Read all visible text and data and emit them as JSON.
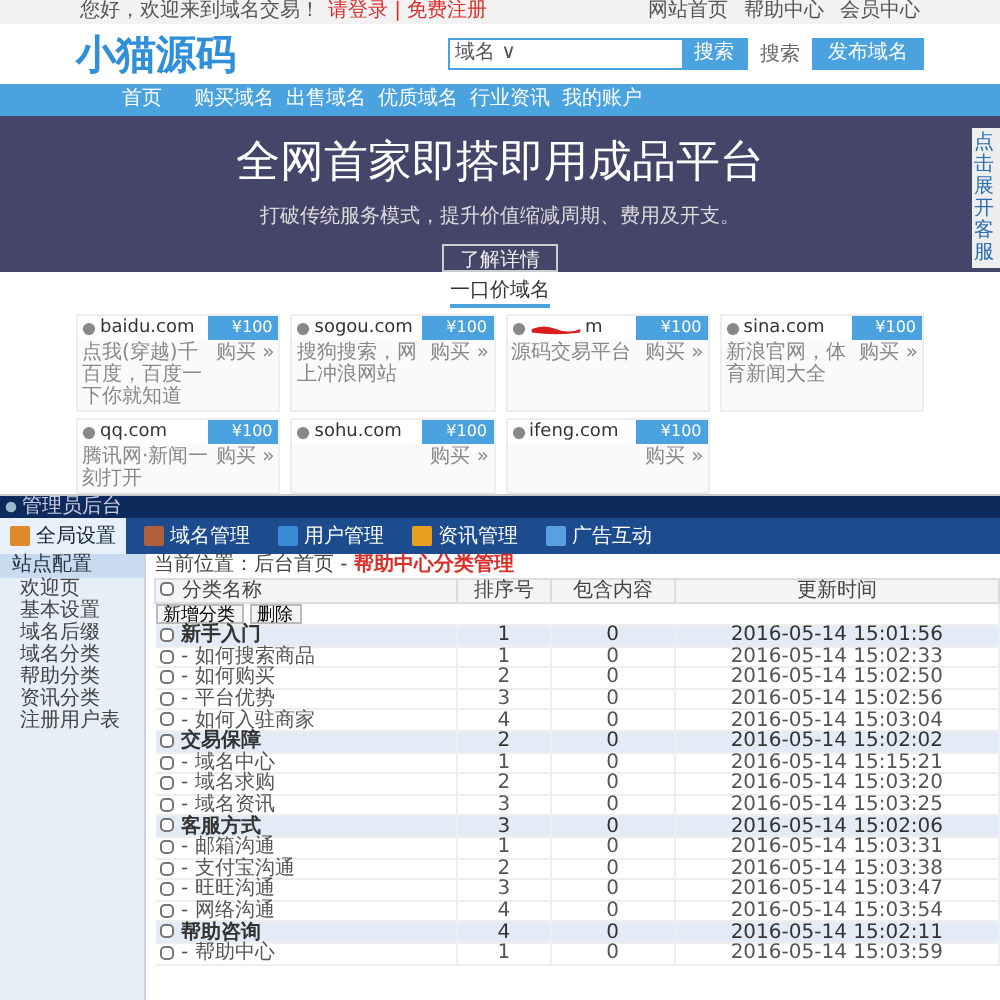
{
  "top_bar": {
    "welcome": "您好，欢迎来到域名交易！",
    "login": "请登录 | 免费注册",
    "links": [
      "网站首页",
      "帮助中心",
      "会员中心"
    ]
  },
  "header": {
    "logo": "小猫源码",
    "search": {
      "select": "域名 ∨",
      "button": "搜索"
    },
    "hint": "搜索",
    "publish": "发布域名"
  },
  "nav": [
    {
      "label": "首页",
      "selected": false
    },
    {
      "label": "购买域名",
      "selected": false
    },
    {
      "label": "出售域名",
      "selected": false
    },
    {
      "label": "优质域名",
      "selected": false
    },
    {
      "label": "行业资讯",
      "selected": false
    },
    {
      "label": "我的账户",
      "selected": false
    }
  ],
  "hero": {
    "title": "全网首家即搭即用成品平台",
    "subtitle": "打破传统服务模式，提升价值缩减周期、费用及开支。",
    "button": "了解详情"
  },
  "side_tab": "点击展开客服",
  "section_title": "一口价域名",
  "domains": [
    {
      "domain": "baidu.com",
      "redacted": false,
      "price": "¥100",
      "desc": "点我(穿越)千百度，百度一下你就知道",
      "buy": "购买 »"
    },
    {
      "domain": "sogou.com",
      "redacted": false,
      "price": "¥100",
      "desc": "搜狗搜索，网上冲浪网站",
      "buy": "购买 »"
    },
    {
      "domain": "m",
      "redacted": true,
      "price": "¥100",
      "desc": "源码交易平台",
      "buy": "购买 »"
    },
    {
      "domain": "sina.com",
      "redacted": false,
      "price": "¥100",
      "desc": "新浪官网，体育新闻大全",
      "buy": "购买 »"
    },
    {
      "domain": "qq.com",
      "redacted": false,
      "price": "¥100",
      "desc": "腾讯网·新闻一刻打开",
      "buy": "购买 »"
    },
    {
      "domain": "sohu.com",
      "redacted": false,
      "price": "¥100",
      "buy": "购买 »"
    },
    {
      "domain": "ifeng.com",
      "redacted": false,
      "price": "¥100",
      "buy": "购买 »"
    }
  ],
  "admin": {
    "title": "管理员后台",
    "tabs": [
      {
        "label": "全局设置",
        "selected": true,
        "color": "#e0892a"
      },
      {
        "label": "域名管理",
        "selected": false,
        "color": "#b0603a"
      },
      {
        "label": "用户管理",
        "selected": false,
        "color": "#3a8ad8"
      },
      {
        "label": "资讯管理",
        "selected": false,
        "color": "#e8a020"
      },
      {
        "label": "广告互动",
        "selected": false,
        "color": "#5aa0e0"
      }
    ],
    "sidebar": {
      "title": "站点配置",
      "items": [
        "欢迎页",
        "基本设置",
        "域名后缀",
        "域名分类",
        "帮助分类",
        "资讯分类",
        "注册用户表"
      ]
    },
    "breadcrumb": {
      "prefix": "当前位置：后台首页 - ",
      "current": "帮助中心分类管理"
    },
    "columns": [
      "分类名称",
      "排序号",
      "包含内容",
      "更新时间"
    ],
    "select_all_checked": false,
    "buttons": [
      "新增分类",
      "删除"
    ],
    "rows": [
      {
        "kind": "group",
        "name": "新手入门",
        "order": "1",
        "count": "0",
        "time": "2016-05-14 15:01:56",
        "checked": false
      },
      {
        "kind": "item",
        "name": "- 如何搜索商品",
        "order": "1",
        "count": "0",
        "time": "2016-05-14 15:02:33",
        "checked": false
      },
      {
        "kind": "item",
        "name": "- 如何购买",
        "order": "2",
        "count": "0",
        "time": "2016-05-14 15:02:50",
        "checked": false
      },
      {
        "kind": "item",
        "name": "- 平台优势",
        "order": "3",
        "count": "0",
        "time": "2016-05-14 15:02:56",
        "checked": false
      },
      {
        "kind": "item",
        "name": "- 如何入驻商家",
        "order": "4",
        "count": "0",
        "time": "2016-05-14 15:03:04",
        "checked": false
      },
      {
        "kind": "group",
        "name": "交易保障",
        "order": "2",
        "count": "0",
        "time": "2016-05-14 15:02:02",
        "checked": false
      },
      {
        "kind": "item",
        "name": "- 域名中心",
        "order": "1",
        "count": "0",
        "time": "2016-05-14 15:15:21",
        "checked": false
      },
      {
        "kind": "item",
        "name": "- 域名求购",
        "order": "2",
        "count": "0",
        "time": "2016-05-14 15:03:20",
        "checked": false
      },
      {
        "kind": "item",
        "name": "- 域名资讯",
        "order": "3",
        "count": "0",
        "time": "2016-05-14 15:03:25",
        "checked": false
      },
      {
        "kind": "group",
        "name": "客服方式",
        "order": "3",
        "count": "0",
        "time": "2016-05-14 15:02:06",
        "checked": false
      },
      {
        "kind": "item",
        "name": "- 邮箱沟通",
        "order": "1",
        "count": "0",
        "time": "2016-05-14 15:03:31",
        "checked": false
      },
      {
        "kind": "item",
        "name": "- 支付宝沟通",
        "order": "2",
        "count": "0",
        "time": "2016-05-14 15:03:38",
        "checked": false
      },
      {
        "kind": "item",
        "name": "- 旺旺沟通",
        "order": "3",
        "count": "0",
        "time": "2016-05-14 15:03:47",
        "checked": false
      },
      {
        "kind": "item",
        "name": "- 网络沟通",
        "order": "4",
        "count": "0",
        "time": "2016-05-14 15:03:54",
        "checked": false
      },
      {
        "kind": "group",
        "name": "帮助咨询",
        "order": "4",
        "count": "0",
        "time": "2016-05-14 15:02:11",
        "checked": false
      },
      {
        "kind": "item",
        "name": "- 帮助中心",
        "order": "1",
        "count": "0",
        "time": "2016-05-14 15:03:59",
        "checked": false
      }
    ]
  }
}
